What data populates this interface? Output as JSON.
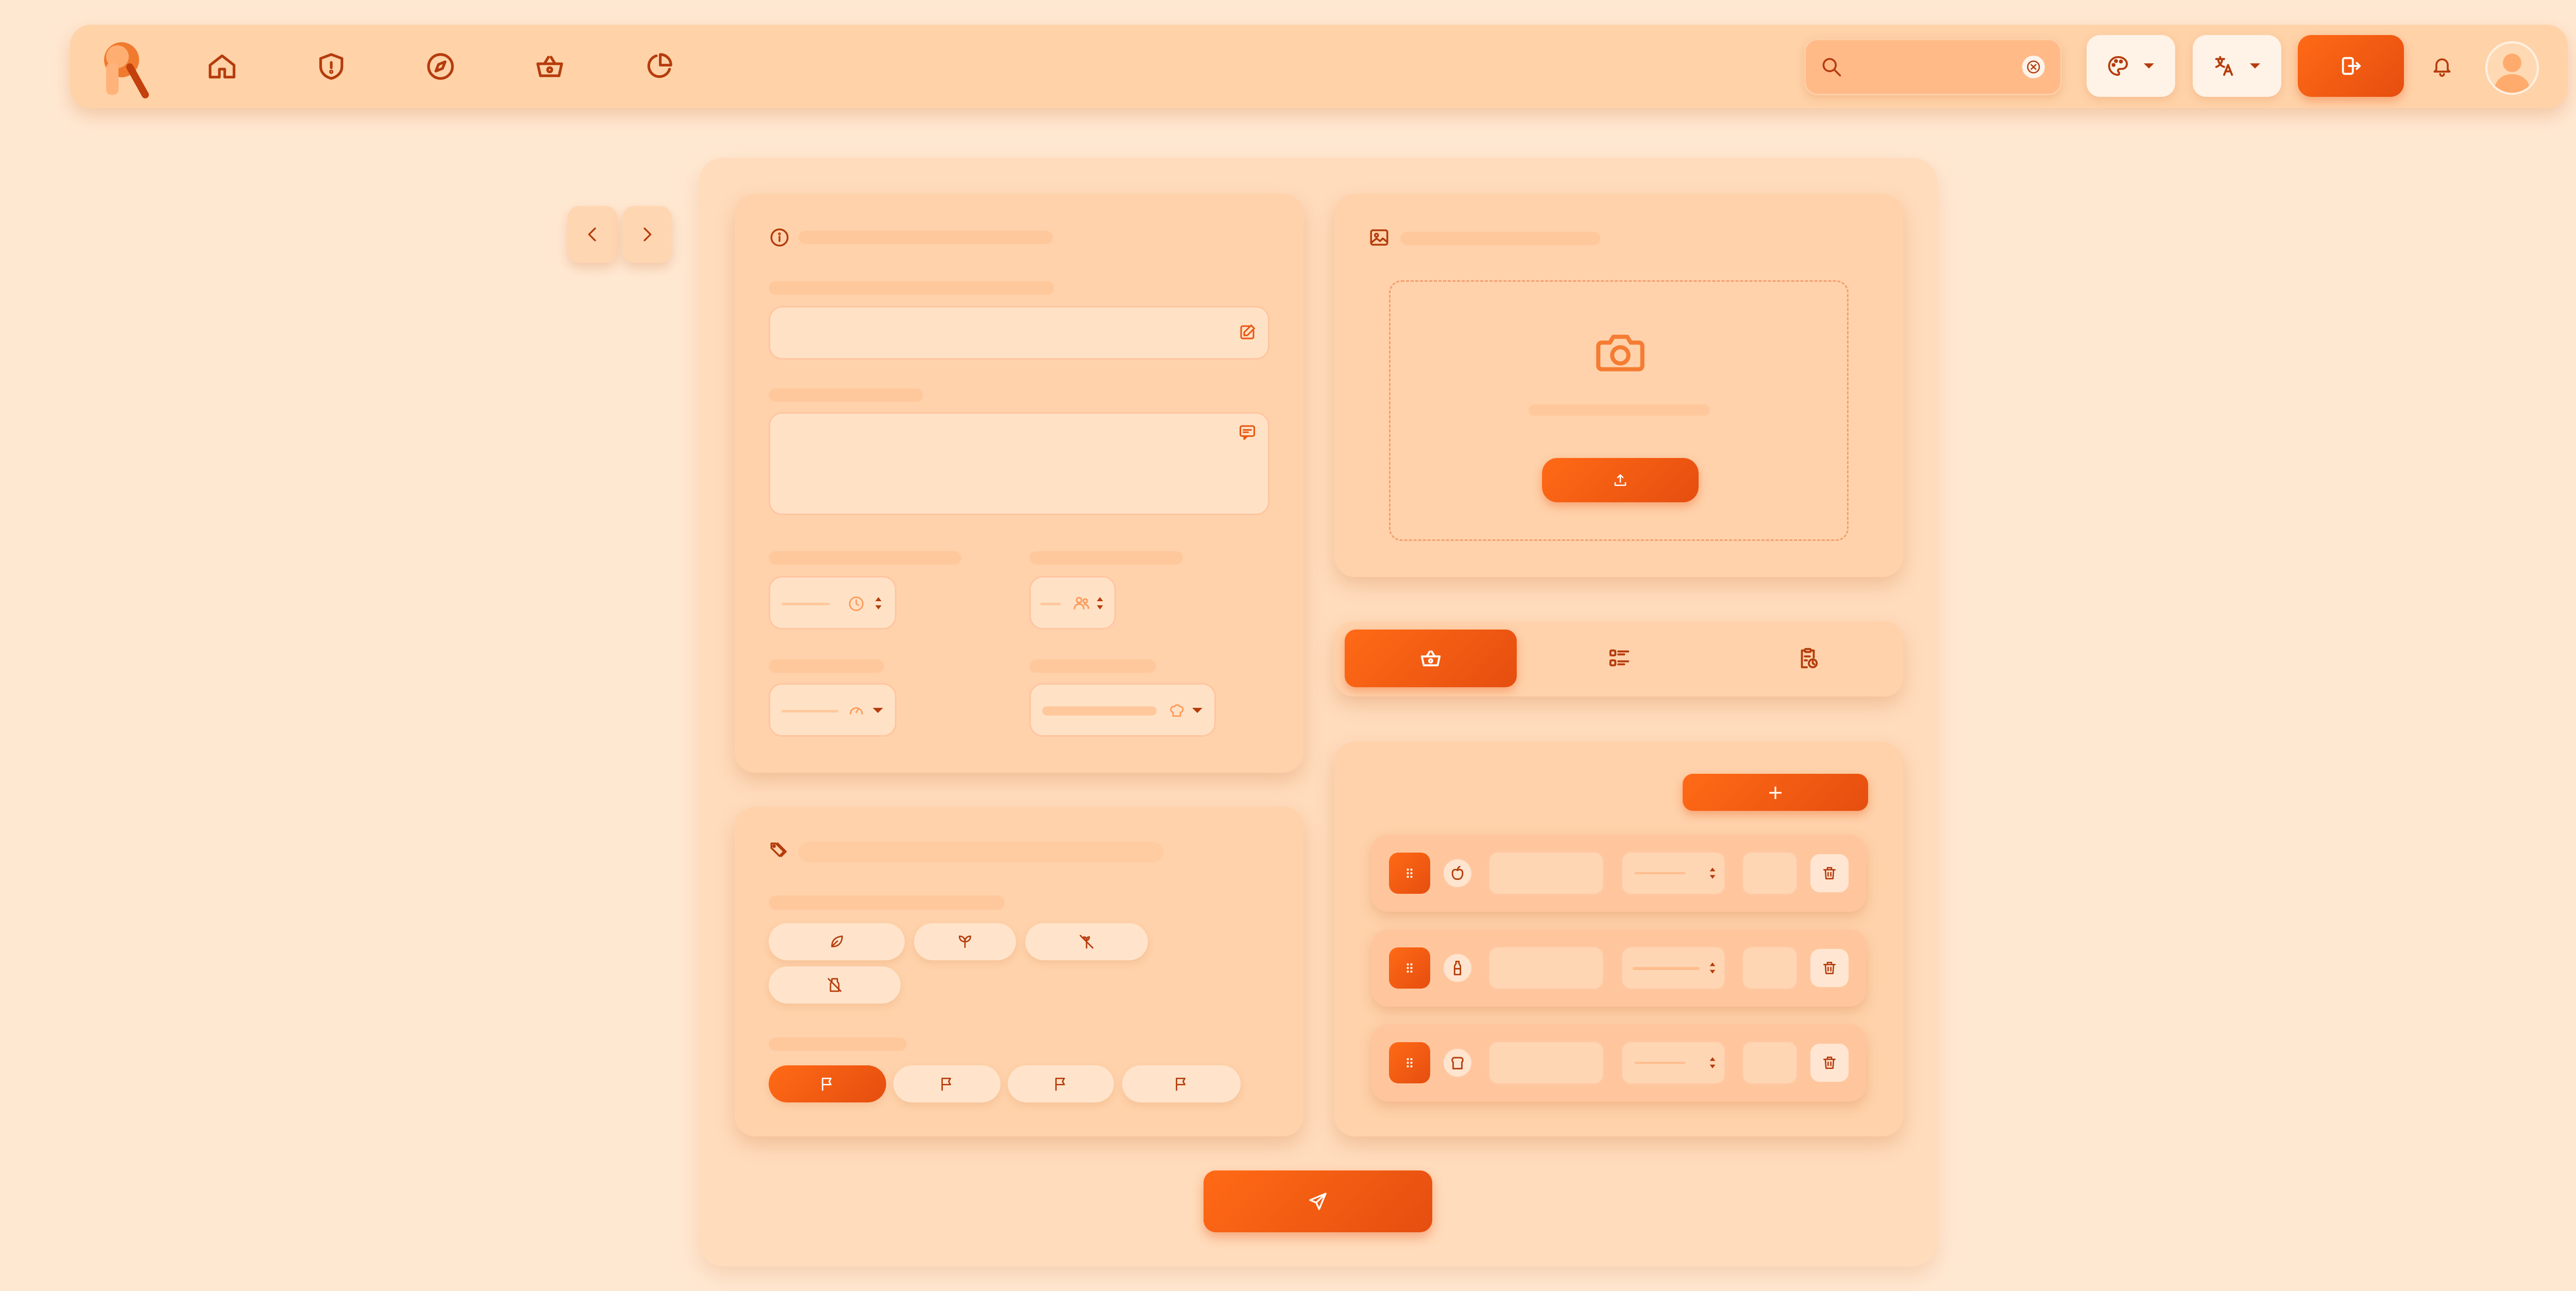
{
  "app": {
    "logo": "R",
    "colors": {
      "background": "#ffe8d2",
      "header": "#ffd2a8",
      "accent": "#f25d12",
      "card": "#ffd2ab"
    }
  },
  "header": {
    "nav": [
      {
        "id": "home",
        "icon": "home-icon"
      },
      {
        "id": "security",
        "icon": "shield-icon"
      },
      {
        "id": "explore",
        "icon": "compass-icon"
      },
      {
        "id": "basket",
        "icon": "basket-icon"
      },
      {
        "id": "stats",
        "icon": "pie-chart-icon"
      }
    ],
    "search": {
      "value": "",
      "placeholder": ""
    },
    "theme_icon": "palette-icon",
    "language_icon": "translate-icon",
    "logout_icon": "logout-icon",
    "bell_icon": "bell-icon",
    "avatar_icon": "user-avatar-icon"
  },
  "form": {
    "info_section": {
      "icon": "info-icon",
      "name_field": "",
      "description_field": "",
      "time_value": "",
      "servings_value": "",
      "difficulty_value": "",
      "cuisine_value": ""
    },
    "tags_section": {
      "icon": "tags-icon",
      "diet_chips": [
        "leaf-icon",
        "vegan-icon",
        "gluten-free-icon",
        "lactose-free-icon"
      ],
      "priority_flags": [
        "flag-icon",
        "flag-icon",
        "flag-icon",
        "flag-icon"
      ],
      "selected_priority": 0
    },
    "image_section": {
      "icon": "image-icon",
      "camera_icon": "camera-icon",
      "upload_icon": "upload-icon"
    },
    "tabs": [
      {
        "icon": "basket-icon",
        "active": true
      },
      {
        "icon": "list-icon",
        "active": false
      },
      {
        "icon": "clipboard-clock-icon",
        "active": false
      }
    ],
    "add_button_label": "+",
    "ingredients": [
      {
        "kind_icon": "apple-icon",
        "name": "",
        "unit": "",
        "qty": ""
      },
      {
        "kind_icon": "bottle-icon",
        "name": "",
        "unit": "",
        "qty": ""
      },
      {
        "kind_icon": "bread-icon",
        "name": "",
        "unit": "",
        "qty": ""
      }
    ],
    "submit_icon": "send-icon"
  }
}
